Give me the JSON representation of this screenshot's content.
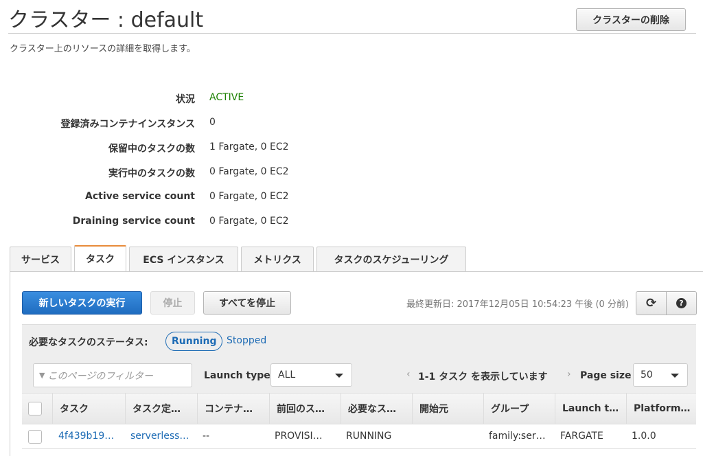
{
  "header": {
    "title": "クラスター : default",
    "subtitle": "クラスター上のリソースの詳細を取得します。",
    "delete_button": "クラスターの削除"
  },
  "details": [
    {
      "label": "状況",
      "value": "ACTIVE"
    },
    {
      "label": "登録済みコンテナインスタンス",
      "value": "0"
    },
    {
      "label": "保留中のタスクの数",
      "value": "1 Fargate, 0 EC2"
    },
    {
      "label": "実行中のタスクの数",
      "value": "0 Fargate, 0 EC2"
    },
    {
      "label": "Active service count",
      "value": "0 Fargate, 0 EC2"
    },
    {
      "label": "Draining service count",
      "value": "0 Fargate, 0 EC2"
    }
  ],
  "status_color": "#1d8102",
  "tabs": [
    {
      "label": "サービス"
    },
    {
      "label": "タスク",
      "active": true
    },
    {
      "label": "ECS インスタンス"
    },
    {
      "label": "メトリクス"
    },
    {
      "label": "タスクのスケジューリング"
    }
  ],
  "toolbar": {
    "run_task": "新しいタスクの実行",
    "stop": "停止",
    "stop_all": "すべてを停止",
    "last_updated": "最終更新日: 2017年12月05日 10:54:23 午後 (0 分前)",
    "refresh_icon": "refresh-icon",
    "help_icon": "help-icon"
  },
  "status_filter": {
    "label": "必要なタスクのステータス:",
    "running": "Running",
    "stopped": "Stopped",
    "selected": "Running"
  },
  "filter": {
    "placeholder": "このページのフィルター",
    "launch_type_label": "Launch type",
    "launch_type_value": "ALL",
    "pagination": "1-1 タスク を表示しています",
    "page_size_label": "Page size",
    "page_size_value": "50"
  },
  "table": {
    "columns": [
      "タスク",
      "タスク定…",
      "コンテナ…",
      "前回のス…",
      "必要なス…",
      "開始元",
      "グループ",
      "Launch t…",
      "Platform…"
    ],
    "rows": [
      [
        "4f439b19…",
        "serverless…",
        "--",
        "PROVISI…",
        "RUNNING",
        "",
        "family:ser…",
        "FARGATE",
        "1.0.0"
      ]
    ]
  },
  "accent": "#1e6cb5",
  "primary_button_color": "#2a7bcc"
}
